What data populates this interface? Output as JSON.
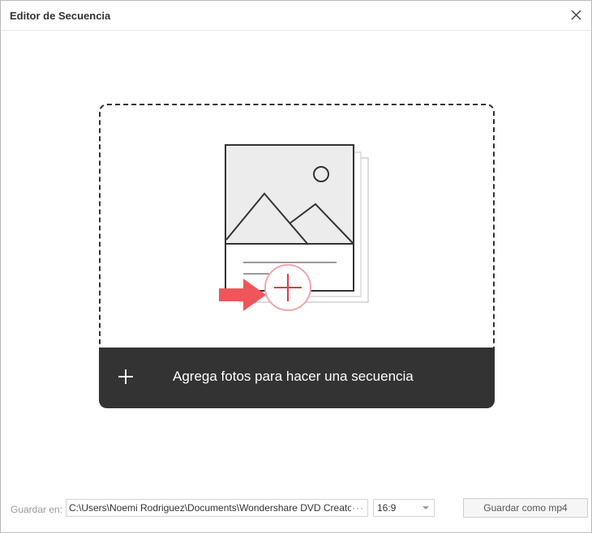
{
  "window": {
    "title": "Editor de Secuencia"
  },
  "dropzone": {
    "add_label": "Agrega fotos para hacer una secuencia"
  },
  "footer": {
    "save_in_label": "Guardar en:",
    "save_path": "C:\\Users\\Noemi Rodriguez\\Documents\\Wondershare DVD Creato",
    "browse_label": "···",
    "aspect_ratio": "16:9",
    "save_button": "Guardar como mp4"
  },
  "colors": {
    "dark": "#333333",
    "accent_red": "#e63946",
    "arrow_red": "#f0555c"
  }
}
